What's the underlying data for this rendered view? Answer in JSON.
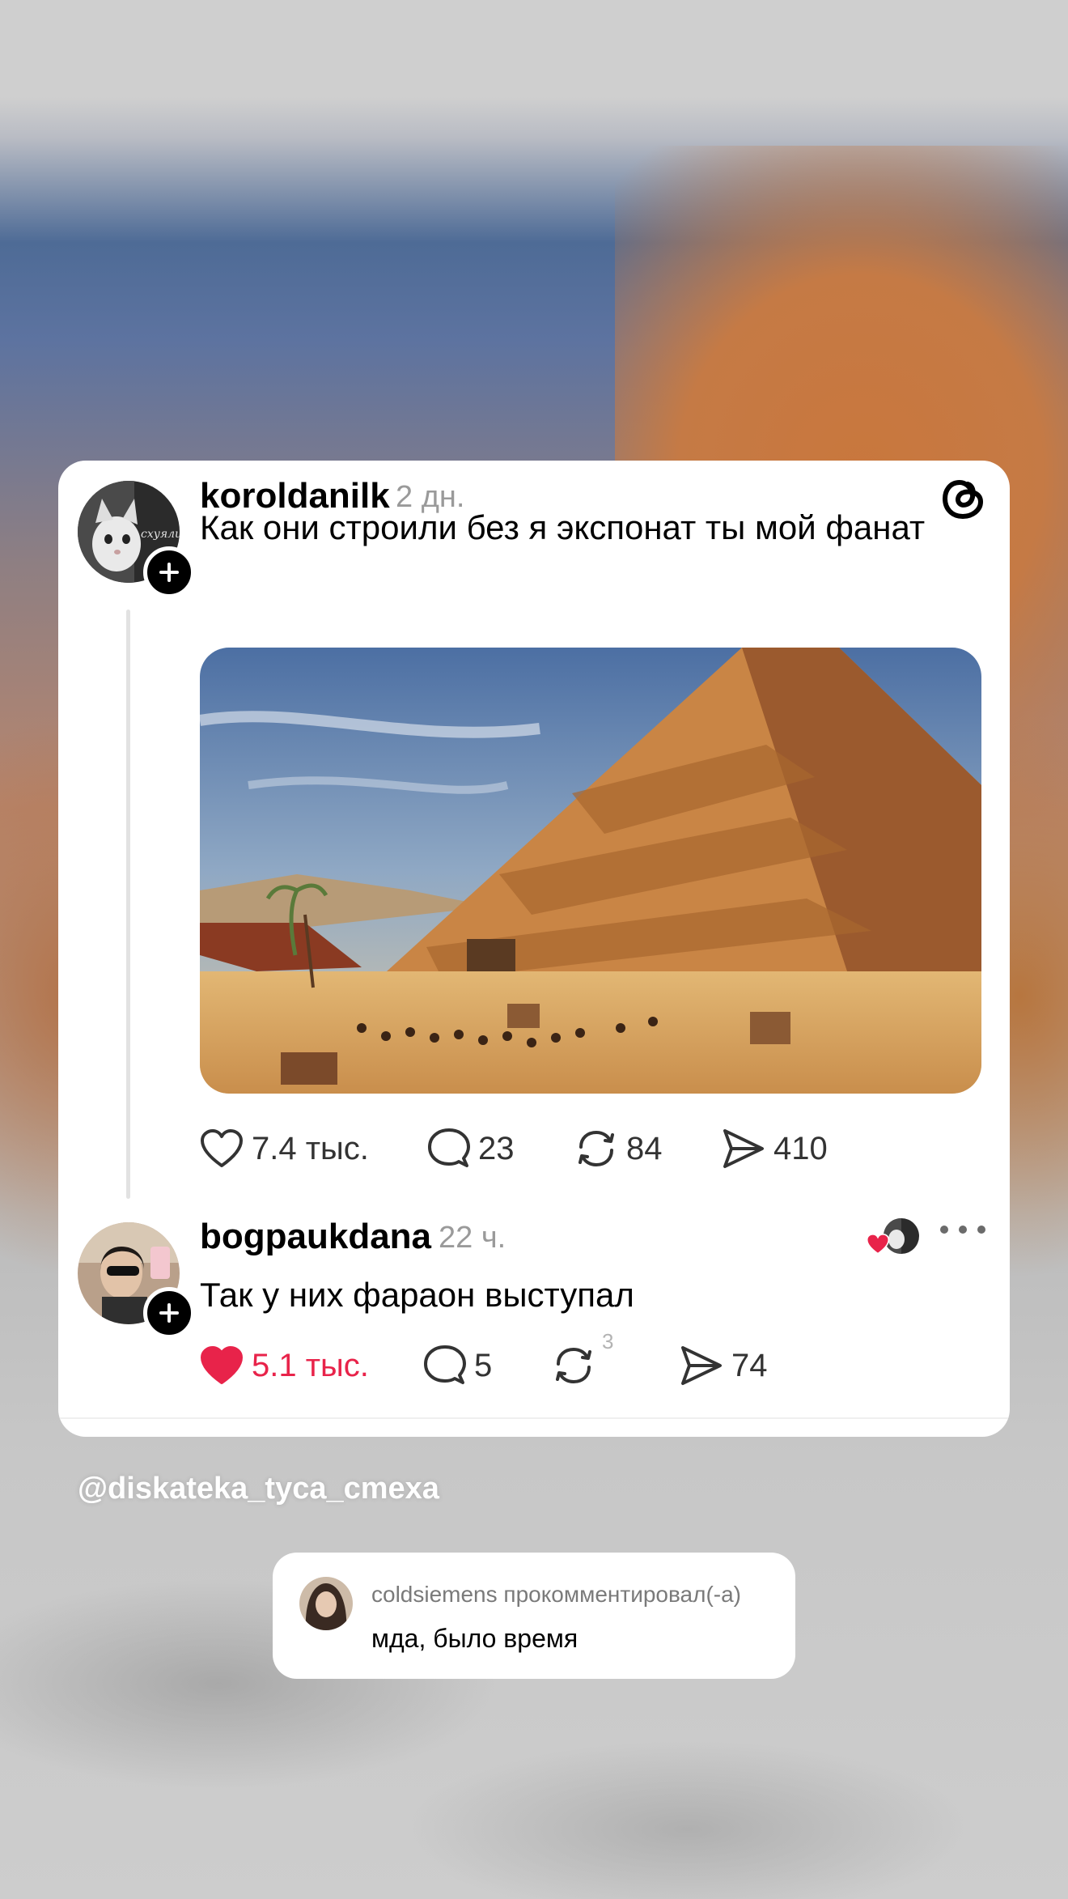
{
  "post": {
    "username": "koroldanilk",
    "time": "2 дн.",
    "text": "Как они строили без я экспонат ты мой фанат",
    "avatar_text": "схуяли",
    "image_description_icon": "pyramid-image",
    "actions": {
      "likes": "7.4 тыс.",
      "comments": "23",
      "reposts": "84",
      "shares": "410"
    }
  },
  "reply": {
    "username": "bogpaukdana",
    "time": "22 ч.",
    "text": "Так у них фараон выступал",
    "actions": {
      "likes": "5.1 тыс.",
      "comments": "5",
      "reposts": "3",
      "shares": "74"
    }
  },
  "watermark": "@diskateka_tyca_cmexa",
  "notification": {
    "title": "coldsiemens прокомментировал(-а)",
    "message": "мда, было время"
  },
  "colors": {
    "like_red": "#e8234a",
    "text_gray": "#9a9a9a"
  },
  "icons": [
    "threads-logo-icon",
    "heart-icon",
    "comment-icon",
    "repost-icon",
    "share-icon",
    "plus-icon",
    "more-icon"
  ]
}
